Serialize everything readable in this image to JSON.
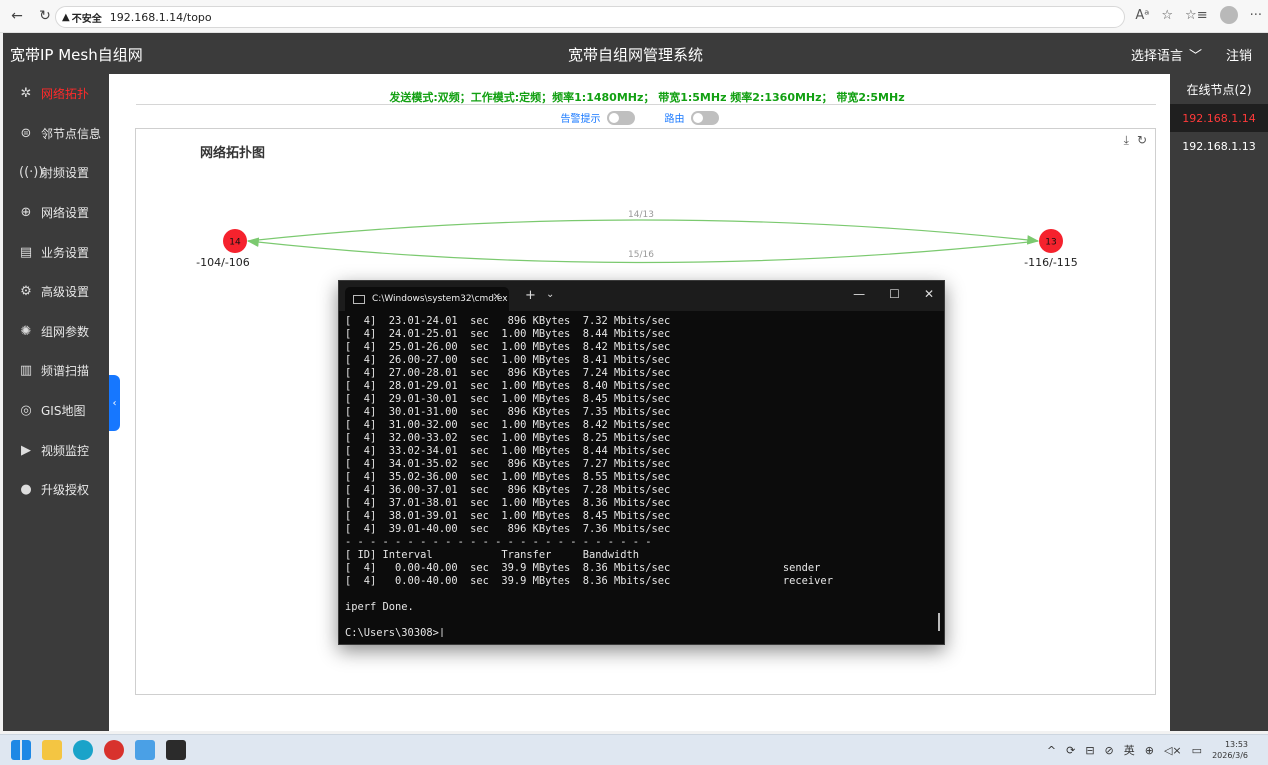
{
  "browser": {
    "insecure_label": "不安全",
    "url": "192.168.1.14/topo"
  },
  "header": {
    "brand": "宽带IP Mesh自组网",
    "system_title": "宽带自组网管理系统",
    "language_label": "选择语言",
    "logout_label": "注销"
  },
  "sidebar": {
    "items": [
      {
        "label": "网络拓扑",
        "icon": "network-topology-icon",
        "active": true
      },
      {
        "label": "邻节点信息",
        "icon": "neighbor-icon"
      },
      {
        "label": "射频设置",
        "icon": "radio-icon"
      },
      {
        "label": "网络设置",
        "icon": "globe-icon"
      },
      {
        "label": "业务设置",
        "icon": "business-icon"
      },
      {
        "label": "高级设置",
        "icon": "gear-icon"
      },
      {
        "label": "组网参数",
        "icon": "mesh-params-icon"
      },
      {
        "label": "频谱扫描",
        "icon": "spectrum-icon"
      },
      {
        "label": "GIS地图",
        "icon": "location-icon"
      },
      {
        "label": "视频监控",
        "icon": "camera-icon"
      },
      {
        "label": "升级授权",
        "icon": "upgrade-icon"
      }
    ]
  },
  "main": {
    "mode_line": "发送模式:双频；工作模式:定频；频率1:1480MHz；  带宽1:5MHz   频率2:1360MHz；  带宽2:5MHz",
    "alarm_label": "告警提示",
    "route_label": "路由",
    "topo_title": "网络拓扑图",
    "nodes": [
      {
        "id": "14",
        "signal": "-104/-106"
      },
      {
        "id": "13",
        "signal": "-116/-115"
      }
    ],
    "links": [
      {
        "label": "14/13"
      },
      {
        "label": "15/16"
      }
    ]
  },
  "right_panel": {
    "title": "在线节点(2)",
    "nodes": [
      "192.168.1.14",
      "192.168.1.13"
    ]
  },
  "terminal": {
    "tab_title": "C:\\Windows\\system32\\cmd.ex",
    "lines": [
      "[  4]  23.01-24.01  sec   896 KBytes  7.32 Mbits/sec",
      "[  4]  24.01-25.01  sec  1.00 MBytes  8.44 Mbits/sec",
      "[  4]  25.01-26.00  sec  1.00 MBytes  8.42 Mbits/sec",
      "[  4]  26.00-27.00  sec  1.00 MBytes  8.41 Mbits/sec",
      "[  4]  27.00-28.01  sec   896 KBytes  7.24 Mbits/sec",
      "[  4]  28.01-29.01  sec  1.00 MBytes  8.40 Mbits/sec",
      "[  4]  29.01-30.01  sec  1.00 MBytes  8.45 Mbits/sec",
      "[  4]  30.01-31.00  sec   896 KBytes  7.35 Mbits/sec",
      "[  4]  31.00-32.00  sec  1.00 MBytes  8.42 Mbits/sec",
      "[  4]  32.00-33.02  sec  1.00 MBytes  8.25 Mbits/sec",
      "[  4]  33.02-34.01  sec  1.00 MBytes  8.44 Mbits/sec",
      "[  4]  34.01-35.02  sec   896 KBytes  7.27 Mbits/sec",
      "[  4]  35.02-36.00  sec  1.00 MBytes  8.55 Mbits/sec",
      "[  4]  36.00-37.01  sec   896 KBytes  7.28 Mbits/sec",
      "[  4]  37.01-38.01  sec  1.00 MBytes  8.36 Mbits/sec",
      "[  4]  38.01-39.01  sec  1.00 MBytes  8.45 Mbits/sec",
      "[  4]  39.01-40.00  sec   896 KBytes  7.36 Mbits/sec",
      "- - - - - - - - - - - - - - - - - - - - - - - - -",
      "[ ID] Interval           Transfer     Bandwidth",
      "[  4]   0.00-40.00  sec  39.9 MBytes  8.36 Mbits/sec                  sender",
      "[  4]   0.00-40.00  sec  39.9 MBytes  8.36 Mbits/sec                  receiver",
      "",
      "iperf Done.",
      "",
      "C:\\Users\\30308>"
    ]
  },
  "taskbar": {
    "ime_label": "英",
    "time": "13:53",
    "date": "2026/3/6"
  },
  "colors": {
    "sidebar_bg": "#3b3b3b",
    "active_red": "#ff2a2a",
    "mode_green": "#12a012",
    "link_green": "#7bc96f",
    "node_red": "#f5222d",
    "accent_blue": "#1677ff"
  }
}
